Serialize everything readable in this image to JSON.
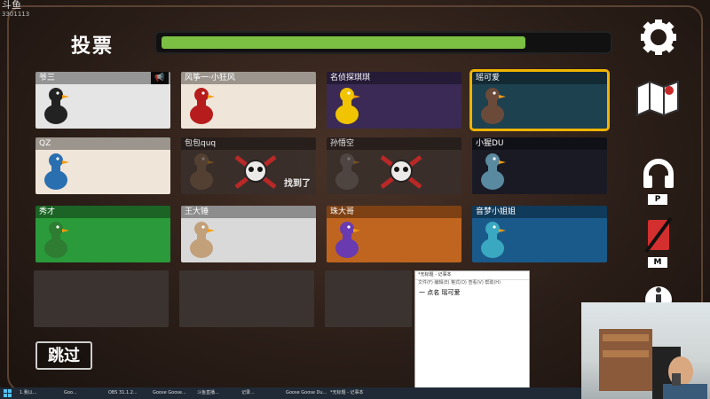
{
  "overlay": {
    "logo_main": "斗鱼",
    "logo_sub": "3301113"
  },
  "header": {
    "title": "投票",
    "timer_fraction": 0.82
  },
  "players": [
    {
      "name": "爷三",
      "bg": "#e5e5e5",
      "avatar_color": "#222"
    },
    {
      "name": "风筝一·小狂风",
      "bg": "#efe5d9",
      "avatar_color": "#b71c1c"
    },
    {
      "name": "名侦探琪琪",
      "bg": "#3a2a55",
      "avatar_color": "#f0c400"
    },
    {
      "name": "瑶可爱",
      "bg": "#1e4150",
      "avatar_color": "#6b4a3a"
    },
    {
      "name": "QZ",
      "bg": "#efe5d9",
      "avatar_color": "#2a6fb0"
    },
    {
      "name": "包包quq",
      "bg": "#3a2f2b",
      "avatar_color": "#8a6a4a",
      "status": "找到了"
    },
    {
      "name": "孙悟空",
      "bg": "#3a2f2b",
      "avatar_color": "#777"
    },
    {
      "name": "小猩DU",
      "bg": "#1a1a24",
      "avatar_color": "#5a8aa0"
    },
    {
      "name": "秀才",
      "bg": "#2a9a3a",
      "avatar_color": "#2e7d32"
    },
    {
      "name": "王大锤",
      "bg": "#d9d9d9",
      "avatar_color": "#c2a07a"
    },
    {
      "name": "珠大哥",
      "bg": "#c0651f",
      "avatar_color": "#6a3ab0"
    },
    {
      "name": "音梦小姐姐",
      "bg": "#1a5a8a",
      "avatar_color": "#3aa8c0"
    }
  ],
  "skip_button": {
    "label": "跳过"
  },
  "side": {
    "ptt_key": "P",
    "mute_key": "M"
  },
  "notepad": {
    "title": "*无标题 - 记事本",
    "menu": "文件(F) 编辑(E) 格式(O) 查看(V) 帮助(H)",
    "text": "一 点名 瑶可爱"
  },
  "taskbar": {
    "items": [
      "1.我以...",
      "Goo...",
      "OBS 31.1.2...",
      "Goose Goose...",
      "斗鱼直播...",
      "记录...",
      "Goose Goose Du...",
      "*无标题 - 记事本"
    ]
  }
}
